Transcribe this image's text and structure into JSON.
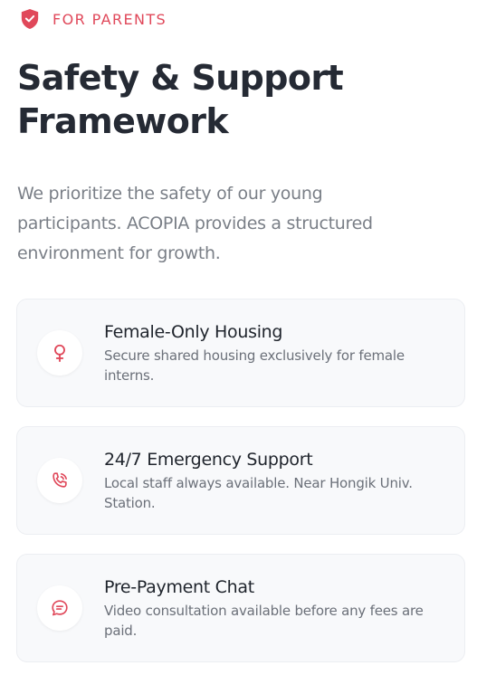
{
  "colors": {
    "accent": "#e0485a",
    "title": "#252a34",
    "body_text": "#7a7f87",
    "card_bg": "#f8f9fb"
  },
  "eyebrow": {
    "icon": "shield-check-icon",
    "label": "FOR PARENTS"
  },
  "header": {
    "title_line1": "Safety & Support",
    "title_line2": "Framework"
  },
  "intro": {
    "line1": "We prioritize the safety of our young",
    "line2": "participants. ACOPIA provides a structured",
    "line3": "environment for growth."
  },
  "features": [
    {
      "icon": "female-symbol-icon",
      "title": "Female-Only Housing",
      "description": "Secure shared housing exclusively for female interns."
    },
    {
      "icon": "phone-call-icon",
      "title": "24/7 Emergency Support",
      "description": "Local staff always available. Near Hongik Univ. Station."
    },
    {
      "icon": "chat-bubble-icon",
      "title": "Pre-Payment Chat",
      "description": "Video consultation available before any fees are paid."
    }
  ]
}
